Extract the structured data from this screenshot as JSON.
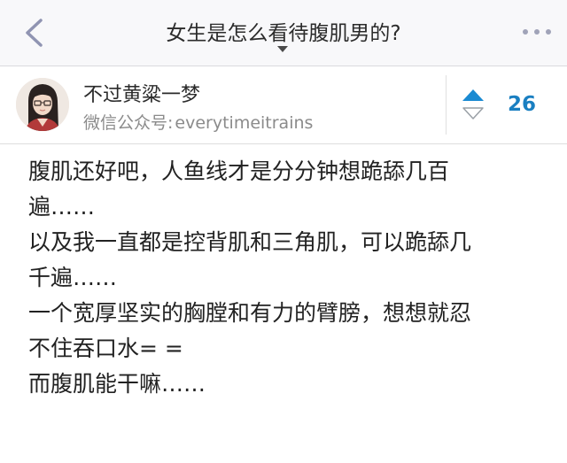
{
  "navbar": {
    "title": "女生是怎么看待腹肌男的?",
    "back_icon": "chevron-left-icon",
    "more_icon": "more-dots-icon",
    "caret_icon": "caret-down-icon"
  },
  "author": {
    "name": "不过黄粱一梦",
    "subtitle_label": "微信公众号:",
    "subtitle_value": "everytimeitrains",
    "avatar_icon": "avatar"
  },
  "votes": {
    "count": "26",
    "up_icon": "vote-up-icon",
    "down_icon": "vote-down-icon",
    "accent": "#1a8ad2"
  },
  "answer": {
    "lines": [
      "腹肌还好吧，人鱼线才是分分钟想跪舔几百",
      "遍……",
      "以及我一直都是控背肌和三角肌，可以跪舔几",
      "千遍……",
      "一个宽厚坚实的胸膛和有力的臂膀，想想就忍",
      "不住吞口水= =",
      "而腹肌能干嘛……"
    ]
  }
}
